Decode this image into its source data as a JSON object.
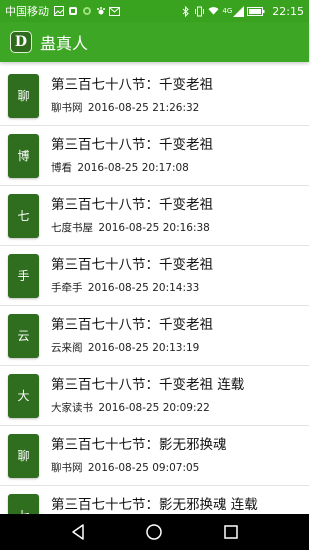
{
  "status_bar": {
    "carrier": "中国移动",
    "network": "4G",
    "time": "22:15"
  },
  "app_bar": {
    "logo_letter": "D",
    "title": "蛊真人"
  },
  "colors": {
    "status_bar": "#39a21f",
    "app_bar": "#3da625",
    "thumb": "#2e6e1e"
  },
  "items": [
    {
      "thumb": "聊",
      "title": "第三百七十八节：千变老祖",
      "source": "聊书网",
      "date": "2016-08-25 21:26:32"
    },
    {
      "thumb": "博",
      "title": "第三百七十八节：千变老祖",
      "source": "博看",
      "date": "2016-08-25 20:17:08"
    },
    {
      "thumb": "七",
      "title": "第三百七十八节：千变老祖",
      "source": "七度书屋",
      "date": "2016-08-25 20:16:38"
    },
    {
      "thumb": "手",
      "title": "第三百七十八节：千变老祖",
      "source": "手牵手",
      "date": "2016-08-25 20:14:33"
    },
    {
      "thumb": "云",
      "title": "第三百七十八节：千变老祖",
      "source": "云来阁",
      "date": "2016-08-25 20:13:19"
    },
    {
      "thumb": "大",
      "title": "第三百七十八节：千变老祖 连载",
      "source": "大家读书",
      "date": "2016-08-25 20:09:22"
    },
    {
      "thumb": "聊",
      "title": "第三百七十七节：影无邪换魂",
      "source": "聊书网",
      "date": "2016-08-25 09:07:05"
    },
    {
      "thumb": "七",
      "title": "第三百七十七节：影无邪换魂 连载",
      "source": "",
      "date": ""
    }
  ],
  "nav_bar": {
    "icons": [
      "back-icon",
      "home-icon",
      "recents-icon"
    ]
  }
}
